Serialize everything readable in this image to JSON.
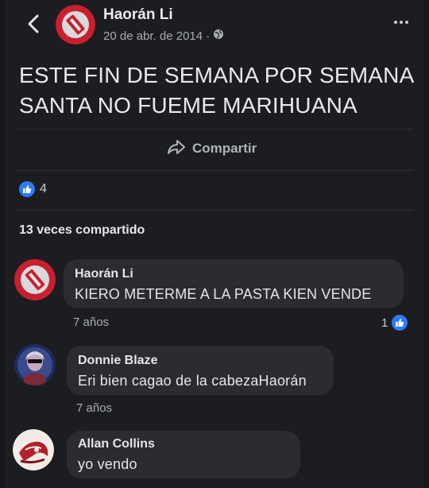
{
  "header": {
    "author": "Haorán Li",
    "date": "20 de abr. de 2014 ·"
  },
  "post": {
    "text": "ESTE FIN DE SEMANA POR SEMANA SANTA NO FUEME MARIHUANA",
    "share_label": "Compartir",
    "like_count": "4",
    "shares_text": "13 veces compartido"
  },
  "comments": [
    {
      "name": "Haorán Li",
      "text": "KIERO METERME A LA PASTA KIEN VENDE",
      "time": "7 años",
      "reactions": "1"
    },
    {
      "name": "Donnie Blaze",
      "text": "Eri bien cagao de la cabezaHaorán",
      "time": "7 años"
    },
    {
      "name": "Allan Collins",
      "text": "yo vendo"
    }
  ],
  "colors": {
    "accent": "#2e7bf6",
    "background": "#1c1d20",
    "bubble": "#2b2c30",
    "avatar_red": "#c8202e"
  },
  "icons": [
    "back-arrow-icon",
    "globe-icon",
    "more-icon",
    "share-icon",
    "like-icon"
  ]
}
